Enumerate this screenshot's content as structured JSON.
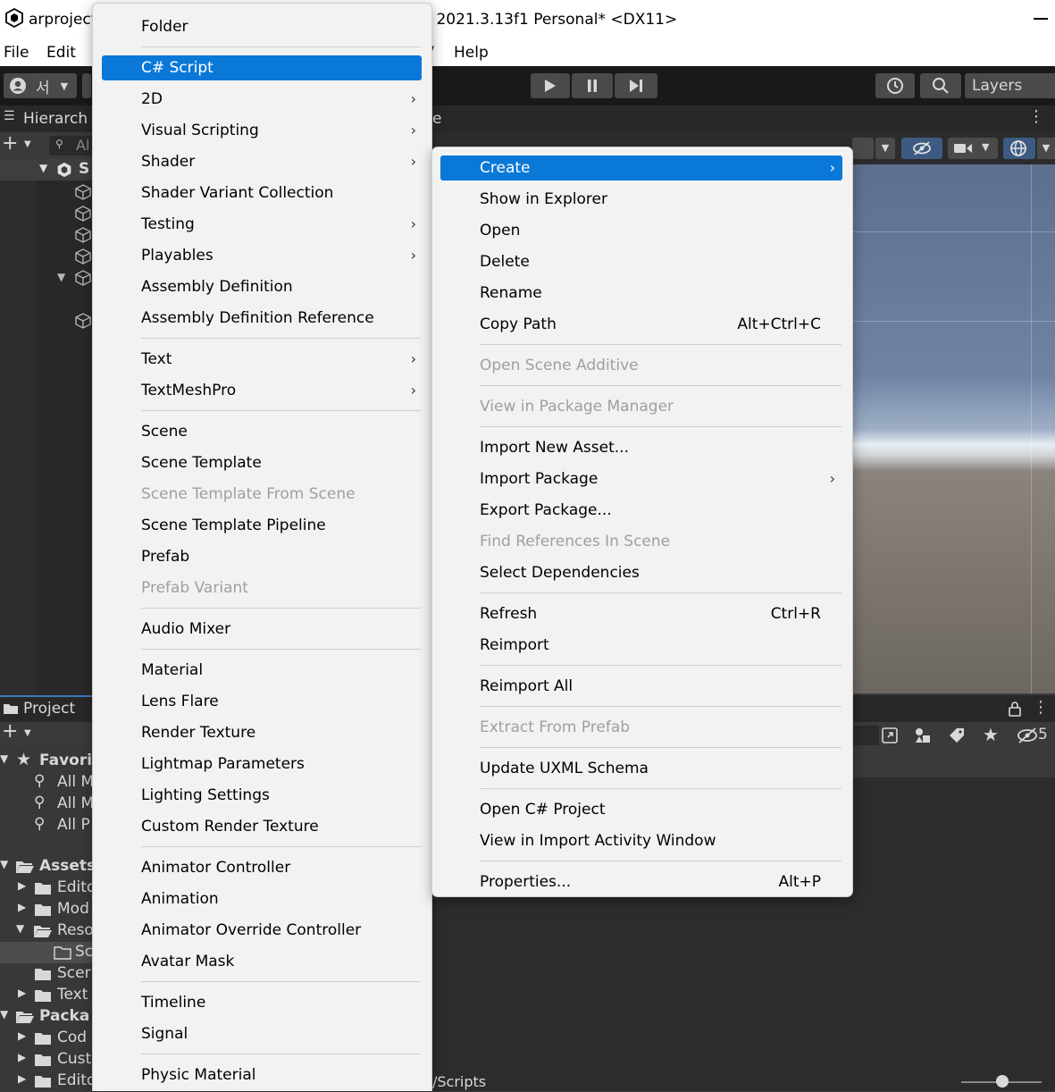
{
  "window": {
    "title_left": "arproject",
    "title_right": "y 2021.3.13f1 Personal* <DX11>"
  },
  "menubar": {
    "file": "File",
    "edit": "Edit",
    "component_tail": "/",
    "help": "Help"
  },
  "toolbar": {
    "account_glyph": "서",
    "layers": "Layers"
  },
  "hierarchy": {
    "tab": "Hierarch",
    "search_placeholder": "Al",
    "scene_row": "S"
  },
  "scene": {
    "tab": "e"
  },
  "project": {
    "tab": "Project",
    "count": "5",
    "path": "/Scripts",
    "tree": [
      {
        "label": "Favori",
        "bold": true
      },
      {
        "label": "All M"
      },
      {
        "label": "All M"
      },
      {
        "label": "All P"
      },
      {
        "label": "Assets",
        "bold": true
      },
      {
        "label": "Edito"
      },
      {
        "label": "Mod"
      },
      {
        "label": "Reso"
      },
      {
        "label": "Sc"
      },
      {
        "label": "Scer"
      },
      {
        "label": "Text"
      },
      {
        "label": "Packa",
        "bold": true
      },
      {
        "label": "Cod"
      },
      {
        "label": "Cust"
      },
      {
        "label": "Edito"
      }
    ]
  },
  "create_menu": {
    "items": [
      {
        "label": "Folder"
      },
      {
        "sep": true
      },
      {
        "label": "C# Script",
        "highlighted": true
      },
      {
        "label": "2D",
        "submenu": true
      },
      {
        "label": "Visual Scripting",
        "submenu": true
      },
      {
        "label": "Shader",
        "submenu": true
      },
      {
        "label": "Shader Variant Collection"
      },
      {
        "label": "Testing",
        "submenu": true
      },
      {
        "label": "Playables",
        "submenu": true
      },
      {
        "label": "Assembly Definition"
      },
      {
        "label": "Assembly Definition Reference"
      },
      {
        "sep": true
      },
      {
        "label": "Text",
        "submenu": true
      },
      {
        "label": "TextMeshPro",
        "submenu": true
      },
      {
        "sep": true
      },
      {
        "label": "Scene"
      },
      {
        "label": "Scene Template"
      },
      {
        "label": "Scene Template From Scene",
        "disabled": true
      },
      {
        "label": "Scene Template Pipeline"
      },
      {
        "label": "Prefab"
      },
      {
        "label": "Prefab Variant",
        "disabled": true
      },
      {
        "sep": true
      },
      {
        "label": "Audio Mixer"
      },
      {
        "sep": true
      },
      {
        "label": "Material"
      },
      {
        "label": "Lens Flare"
      },
      {
        "label": "Render Texture"
      },
      {
        "label": "Lightmap Parameters"
      },
      {
        "label": "Lighting Settings"
      },
      {
        "label": "Custom Render Texture"
      },
      {
        "sep": true
      },
      {
        "label": "Animator Controller"
      },
      {
        "label": "Animation"
      },
      {
        "label": "Animator Override Controller"
      },
      {
        "label": "Avatar Mask"
      },
      {
        "sep": true
      },
      {
        "label": "Timeline"
      },
      {
        "label": "Signal"
      },
      {
        "sep": true
      },
      {
        "label": "Physic Material"
      }
    ]
  },
  "context_menu": {
    "items": [
      {
        "label": "Create",
        "submenu": true,
        "highlighted": true
      },
      {
        "label": "Show in Explorer"
      },
      {
        "label": "Open"
      },
      {
        "label": "Delete"
      },
      {
        "label": "Rename"
      },
      {
        "label": "Copy Path",
        "shortcut": "Alt+Ctrl+C"
      },
      {
        "sep": true
      },
      {
        "label": "Open Scene Additive",
        "disabled": true
      },
      {
        "sep": true
      },
      {
        "label": "View in Package Manager",
        "disabled": true
      },
      {
        "sep": true
      },
      {
        "label": "Import New Asset..."
      },
      {
        "label": "Import Package",
        "submenu": true
      },
      {
        "label": "Export Package..."
      },
      {
        "label": "Find References In Scene",
        "disabled": true
      },
      {
        "label": "Select Dependencies"
      },
      {
        "sep": true
      },
      {
        "label": "Refresh",
        "shortcut": "Ctrl+R"
      },
      {
        "label": "Reimport"
      },
      {
        "sep": true
      },
      {
        "label": "Reimport All"
      },
      {
        "sep": true
      },
      {
        "label": "Extract From Prefab",
        "disabled": true
      },
      {
        "sep": true
      },
      {
        "label": "Update UXML Schema"
      },
      {
        "sep": true
      },
      {
        "label": "Open C# Project"
      },
      {
        "label": "View in Import Activity Window"
      },
      {
        "sep": true
      },
      {
        "label": "Properties...",
        "shortcut": "Alt+P"
      }
    ]
  },
  "icons": {
    "unity_logo": "unity-logo-icon",
    "submenu_arrow": "chevron-right-icon",
    "play": "play-icon",
    "pause": "pause-icon",
    "step": "step-icon",
    "history": "history-icon",
    "search": "search-icon"
  },
  "colors": {
    "menu_highlight": "#0a78d7",
    "menu_bg": "#f2f2f2",
    "disabled_text": "#9f9f9f",
    "editor_dark": "#282828"
  }
}
